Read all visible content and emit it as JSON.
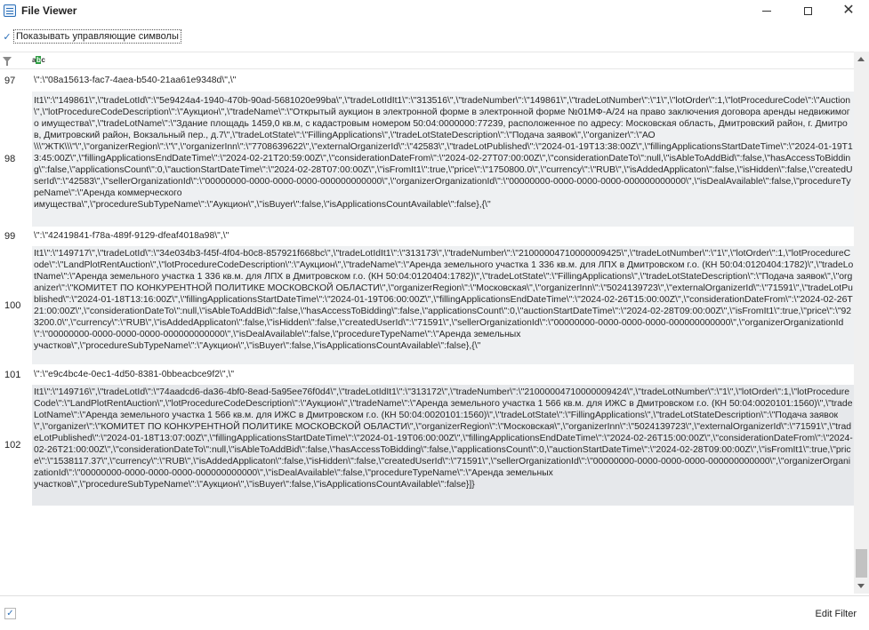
{
  "window": {
    "title": "File Viewer",
    "minimize_glyph": "—",
    "close_glyph": "✕"
  },
  "options": {
    "show_control_chars_label": "Показывать управляющие символы",
    "show_control_chars_checked": true,
    "check_glyph": "✓"
  },
  "filter_bar": {
    "column_icon": "abc-column-icon",
    "abc": [
      "a",
      "b",
      "c"
    ]
  },
  "rows": [
    {
      "num": "97",
      "text": "\\\":\\\"08a15613-fac7-4aea-b540-21aa61e9348d\\\",\\\""
    },
    {
      "num": "98",
      "text": "It1\\\":\\\"149861\\\",\\\"tradeLotId\\\":\\\"5e9424a4-1940-470b-90ad-5681020e99ba\\\",\\\"tradeLotIdIt1\\\":\\\"313516\\\",\\\"tradeNumber\\\":\\\"149861\\\",\\\"tradeLotNumber\\\":\\\"1\\\",\\\"lotOrder\\\":1,\\\"lotProcedureCode\\\":\\\"Auction\\\",\\\"lotProcedureCodeDescription\\\":\\\"Аукцион\\\",\\\"tradeName\\\":\\\"Открытый аукцион в электронной форме в электронной форме №01МФ-А/24 на право заключения договора аренды недвижимого имущества\\\",\\\"tradeLotName\\\":\\\"Здание площадь 1459,0 кв.м, с кадастровым номером 50:04:0000000:77239, расположенное по адресу: Московская область, Дмитровский район, г. Дмитров, Дмитровский район, Вокзальный пер., д.7\\\",\\\"tradeLotState\\\":\\\"FillingApplications\\\",\\\"tradeLotStateDescription\\\":\\\"Подача заявок\\\",\\\"organizer\\\":\\\"АО\n\\\\\\\"ЖТК\\\\\\\"\\\",\\\"organizerRegion\\\":\\\"\\\",\\\"organizerInn\\\":\\\"7708639622\\\",\\\"externalOrganizerId\\\":\\\"42583\\\",\\\"tradeLotPublished\\\":\\\"2024-01-19T13:38:00Z\\\",\\\"fillingApplicationsStartDateTime\\\":\\\"2024-01-19T13:45:00Z\\\",\\\"fillingApplicationsEndDateTime\\\":\\\"2024-02-21T20:59:00Z\\\",\\\"considerationDateFrom\\\":\\\"2024-02-27T07:00:00Z\\\",\\\"considerationDateTo\\\":null,\\\"isAbleToAddBid\\\":false,\\\"hasAccessToBidding\\\":false,\\\"applicationsCount\\\":0,\\\"auctionStartDateTime\\\":\\\"2024-02-28T07:00:00Z\\\",\\\"isFromIt1\\\":true,\\\"price\\\":\\\"1750800.0\\\",\\\"currency\\\":\\\"RUB\\\",\\\"isAddedApplicaton\\\":false,\\\"isHidden\\\":false,\\\"createdUserId\\\":\\\"42583\\\",\\\"sellerOrganizationId\\\":\\\"00000000-0000-0000-0000-000000000000\\\",\\\"organizerOrganizationId\\\":\\\"00000000-0000-0000-0000-000000000000\\\",\\\"isDealAvailable\\\":false,\\\"procedureTypeName\\\":\\\"Аренда коммерческого\nимущества\\\",\\\"procedureSubTypeName\\\":\\\"Аукцион\\\",\\\"isBuyer\\\":false,\\\"isApplicationsCountAvailable\\\":false},{\\\""
    },
    {
      "num": "99",
      "text": "\\\":\\\"42419841-f78a-489f-9129-dfeaf4018a98\\\",\\\""
    },
    {
      "num": "100",
      "text": "It1\\\":\\\"149717\\\",\\\"tradeLotId\\\":\\\"34e034b3-f45f-4f04-b0c8-857921f668bc\\\",\\\"tradeLotIdIt1\\\":\\\"313173\\\",\\\"tradeNumber\\\":\\\"21000004710000009425\\\",\\\"tradeLotNumber\\\":\\\"1\\\",\\\"lotOrder\\\":1,\\\"lotProcedureCode\\\":\\\"LandPlotRentAuction\\\",\\\"lotProcedureCodeDescription\\\":\\\"Аукцион\\\",\\\"tradeName\\\":\\\"Аренда земельного участка 1 336 кв.м. для ЛПХ в Дмитровском г.о. (КН 50:04:0120404:1782)\\\",\\\"tradeLotName\\\":\\\"Аренда земельного участка 1 336 кв.м. для ЛПХ в Дмитровском г.о. (КН 50:04:0120404:1782)\\\",\\\"tradeLotState\\\":\\\"FillingApplications\\\",\\\"tradeLotStateDescription\\\":\\\"Подача заявок\\\",\\\"organizer\\\":\\\"КОМИТЕТ ПО КОНКУРЕНТНОЙ ПОЛИТИКЕ МОСКОВСКОЙ ОБЛАСТИ\\\",\\\"organizerRegion\\\":\\\"Московская\\\",\\\"organizerInn\\\":\\\"5024139723\\\",\\\"externalOrganizerId\\\":\\\"71591\\\",\\\"tradeLotPublished\\\":\\\"2024-01-18T13:16:00Z\\\",\\\"fillingApplicationsStartDateTime\\\":\\\"2024-01-19T06:00:00Z\\\",\\\"fillingApplicationsEndDateTime\\\":\\\"2024-02-26T15:00:00Z\\\",\\\"considerationDateFrom\\\":\\\"2024-02-26T21:00:00Z\\\",\\\"considerationDateTo\\\":null,\\\"isAbleToAddBid\\\":false,\\\"hasAccessToBidding\\\":false,\\\"applicationsCount\\\":0,\\\"auctionStartDateTime\\\":\\\"2024-02-28T09:00:00Z\\\",\\\"isFromIt1\\\":true,\\\"price\\\":\\\"923200.0\\\",\\\"currency\\\":\\\"RUB\\\",\\\"isAddedApplicaton\\\":false,\\\"isHidden\\\":false,\\\"createdUserId\\\":\\\"71591\\\",\\\"sellerOrganizationId\\\":\\\"00000000-0000-0000-0000-000000000000\\\",\\\"organizerOrganizationId\\\":\\\"00000000-0000-0000-0000-000000000000\\\",\\\"isDealAvailable\\\":false,\\\"procedureTypeName\\\":\\\"Аренда земельных\nучастков\\\",\\\"procedureSubTypeName\\\":\\\"Аукцион\\\",\\\"isBuyer\\\":false,\\\"isApplicationsCountAvailable\\\":false},{\\\""
    },
    {
      "num": "101",
      "text": "\\\":\\\"e9c4bc4e-0ec1-4d50-8381-0bbeacbce9f2\\\",\\\""
    },
    {
      "num": "102",
      "text": "It1\\\":\\\"149716\\\",\\\"tradeLotId\\\":\\\"74aadcd6-da36-4bf0-8ead-5a95ee76f0d4\\\",\\\"tradeLotIdIt1\\\":\\\"313172\\\",\\\"tradeNumber\\\":\\\"21000004710000009424\\\",\\\"tradeLotNumber\\\":\\\"1\\\",\\\"lotOrder\\\":1,\\\"lotProcedureCode\\\":\\\"LandPlotRentAuction\\\",\\\"lotProcedureCodeDescription\\\":\\\"Аукцион\\\",\\\"tradeName\\\":\\\"Аренда земельного участка 1 566 кв.м. для ИЖС в Дмитровском г.о. (КН 50:04:0020101:1560)\\\",\\\"tradeLotName\\\":\\\"Аренда земельного участка 1 566 кв.м. для ИЖС в Дмитровском г.о. (КН 50:04:0020101:1560)\\\",\\\"tradeLotState\\\":\\\"FillingApplications\\\",\\\"tradeLotStateDescription\\\":\\\"Подача заявок\\\",\\\"organizer\\\":\\\"КОМИТЕТ ПО КОНКУРЕНТНОЙ ПОЛИТИКЕ МОСКОВСКОЙ ОБЛАСТИ\\\",\\\"organizerRegion\\\":\\\"Московская\\\",\\\"organizerInn\\\":\\\"5024139723\\\",\\\"externalOrganizerId\\\":\\\"71591\\\",\\\"tradeLotPublished\\\":\\\"2024-01-18T13:07:00Z\\\",\\\"fillingApplicationsStartDateTime\\\":\\\"2024-01-19T06:00:00Z\\\",\\\"fillingApplicationsEndDateTime\\\":\\\"2024-02-26T15:00:00Z\\\",\\\"considerationDateFrom\\\":\\\"2024-02-26T21:00:00Z\\\",\\\"considerationDateTo\\\":null,\\\"isAbleToAddBid\\\":false,\\\"hasAccessToBidding\\\":false,\\\"applicationsCount\\\":0,\\\"auctionStartDateTime\\\":\\\"2024-02-28T09:00:00Z\\\",\\\"isFromIt1\\\":true,\\\"price\\\":\\\"1538117.37\\\",\\\"currency\\\":\\\"RUB\\\",\\\"isAddedApplicaton\\\":false,\\\"isHidden\\\":false,\\\"createdUserId\\\":\\\"71591\\\",\\\"sellerOrganizationId\\\":\\\"00000000-0000-0000-0000-000000000000\\\",\\\"organizerOrganizationId\\\":\\\"00000000-0000-0000-0000-000000000000\\\",\\\"isDealAvailable\\\":false,\\\"procedureTypeName\\\":\\\"Аренда земельных\nучастков\\\",\\\"procedureSubTypeName\\\":\\\"Аукцион\\\",\\\"isBuyer\\\":false,\\\"isApplicationsCountAvailable\\\":false}]}"
    }
  ],
  "footer": {
    "filter_checked": true,
    "check_glyph": "✓",
    "edit_filter_label": "Edit Filter"
  }
}
